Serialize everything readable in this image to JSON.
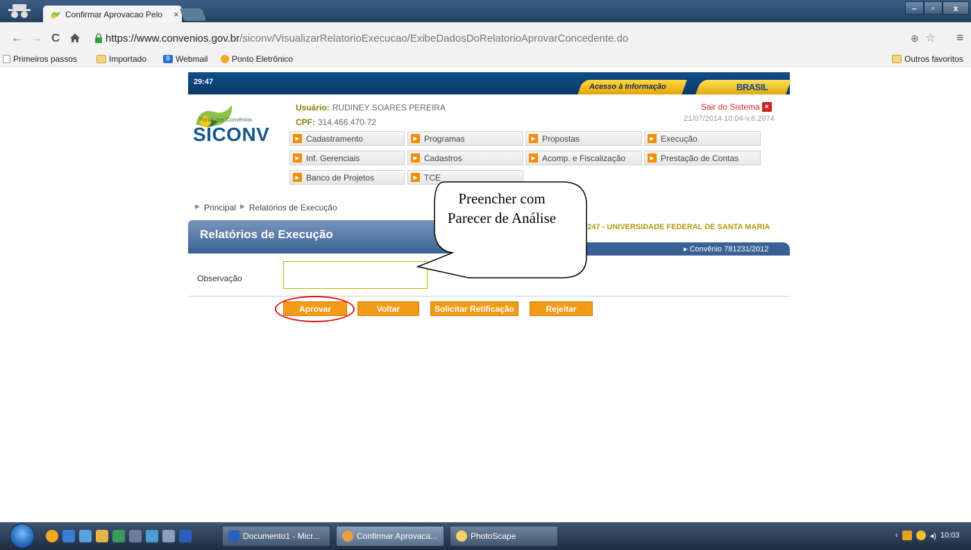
{
  "browser": {
    "tab_title": "Confirmar Aprovacao Pelo",
    "tab_close": "×",
    "url_host": "https://www.convenios.gov.br",
    "url_path": "/siconv/VisualizarRelatorioExecucao/ExibeDadosDoRelatorioAprovarConcedente.do",
    "bookmarks": [
      "Primeiros passos",
      "Importado",
      "Webmail",
      "Ponto Eletrônico"
    ],
    "other_bookmarks": "Outros favoritos",
    "window_controls": [
      "–",
      "▫",
      "x"
    ]
  },
  "header": {
    "timer": "29:47",
    "acesso": "Acesso à Informação",
    "brasil": "BRASIL",
    "logo_sub": "Portal dos Convênios",
    "logo_text": "SICONV",
    "user_label": "Usuário:",
    "user_name": "RUDINEY SOARES PEREIRA",
    "cpf_label": "CPF:",
    "cpf": "314.466.470-72",
    "logout": "Sair do Sistema",
    "date_version": "21/07/2014 10:04-v.6.2974"
  },
  "menu": [
    "Cadastramento",
    "Programas",
    "Propostas",
    "Execução",
    "Inf. Gerenciais",
    "Cadastros",
    "Acomp. e Fiscalização",
    "Prestação de Contas",
    "Banco de Projetos",
    "TCE"
  ],
  "breadcrumb": [
    "Principal",
    "Relatórios de Execução"
  ],
  "panel": {
    "title": "Relatórios de Execução",
    "org": "6247 - UNIVERSIDADE FEDERAL DE SANTA MARIA",
    "convenio": "Convênio 781231/2012"
  },
  "form": {
    "obs_label": "Observação",
    "obs_value": ""
  },
  "buttons": {
    "aprovar": "Aprovar",
    "voltar": "Voltar",
    "solicitar": "Solicitar Retificação",
    "rejeitar": "Rejeitar"
  },
  "callout": {
    "text": "Preencher com Parecer de Análise"
  },
  "taskbar": {
    "tasks": [
      "Documento1 - Micr...",
      "Confirmar Aprovaca...",
      "PhotoScape"
    ],
    "clock": "10:03"
  }
}
